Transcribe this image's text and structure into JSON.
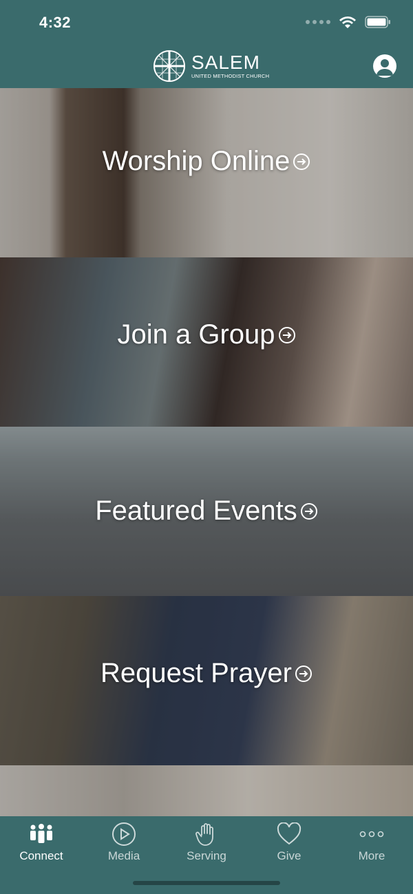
{
  "status_bar": {
    "time": "4:32"
  },
  "header": {
    "logo_title": "SALEM",
    "logo_subtitle": "UNITED METHODIST CHURCH"
  },
  "feed": {
    "tiles": [
      {
        "label": "Worship Online"
      },
      {
        "label": "Join a Group"
      },
      {
        "label": "Featured Events"
      },
      {
        "label": "Request Prayer"
      }
    ]
  },
  "tab_bar": {
    "tabs": [
      {
        "label": "Connect",
        "icon": "people-icon",
        "active": true
      },
      {
        "label": "Media",
        "icon": "play-icon",
        "active": false
      },
      {
        "label": "Serving",
        "icon": "hand-icon",
        "active": false
      },
      {
        "label": "Give",
        "icon": "heart-icon",
        "active": false
      },
      {
        "label": "More",
        "icon": "more-dots-icon",
        "active": false
      }
    ]
  },
  "colors": {
    "header_bg": "#3a6b6c",
    "tab_active": "#ffffff"
  }
}
